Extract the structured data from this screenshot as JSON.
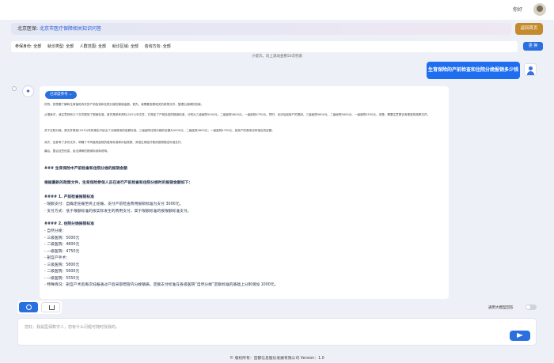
{
  "header": {
    "greeting": "你好"
  },
  "breadcrumb": {
    "prefix": "北京医保:",
    "title": "北京市医疗保障相关知识问答"
  },
  "buttons": {
    "home": "返回首页",
    "change": "更 换",
    "reference": "已深度参考 ⌄"
  },
  "filters": [
    "参保身份: 全部",
    "就诊类型: 全部",
    "人群范围: 全部",
    "就诊区域: 全部",
    "咨询方向: 全部"
  ],
  "tip": "小提示。向上滚动查看50次检索",
  "question": "生育保险的产前检查和住院分娩报销多少钱",
  "answer": {
    "small_paragraphs": [
      "好的，您想要了解和生育保险有关的产前检查和住院分娩的报销金额。首先，我需要查看相关的政策文件，整理出准确的答案。",
      "从搜索中，我注意到有几个文件提到了报销标准。首先是参考资料(2021)年文件，它规定了产前检查的报销标准，分别为三级医院5000元、二级医院4800元、一级医院4750元。同时，也涉及剖宫产的费用，三级医院5800元、二级医院5600元、一级医院5550元。但是，需要注意是否有更新的政策文件。",
      "关于住院分娩，原文件提到(2019)年的规定中给出了分娩费用的定额标准。三级医院住院分娩的定额为5000元，二级医院4800元，一级医院4750元。剖宫产的费用也有相应的定额。",
      "另外，还参考了多份文件，明确了不同级别医院的费用标准和补贴政策。其他生育医疗费用按照规定标准支付。",
      "最后，整合这些信息，给出清晰的报销标准和说明。"
    ],
    "heading": "### 生育保险中产前检查和住院分娩的报销金额",
    "intro": "根据最新的政策文件，生育保险参保人员在进行产前检查和住院分娩时的报销金额如下：",
    "sec1": "#### 1. 产前检查报销标准",
    "sec1_items": [
      "- 限额支付：自确定妊娠至终止妊娠，支付产前检查费用报销标准为支付 3000元。",
      "- 支付方式：低于限额标准的按实际发生的费用支付，高于限额标准的按限额标准支付。"
    ],
    "sec2": "#### 2. 住院分娩报销标准",
    "sec2_items": [
      "- 自然分娩：",
      "  - 三级医院：5000元",
      "  - 二级医院：4800元",
      "  - 一级医院：4750元",
      "- 剖宫产手术：",
      "  - 三级医院：5800元",
      "  - 二级医院：5600元",
      "  - 一级医院：5550元",
      "- 特殊情况：剖宫产术后再次妊娠通过产后采取暗管内分娩镇痛，定额支付标准在各级医院“自然分娩”定额标准的基础上分别增加 1000元。"
    ]
  },
  "toggle": {
    "label": "通用大模型回答"
  },
  "input": {
    "placeholder": "您好，我是医保数字人，您有什么问题可随时找我的。"
  },
  "footer": "© 版权所有：首都信息股份发展有限公司 Version：1.0"
}
